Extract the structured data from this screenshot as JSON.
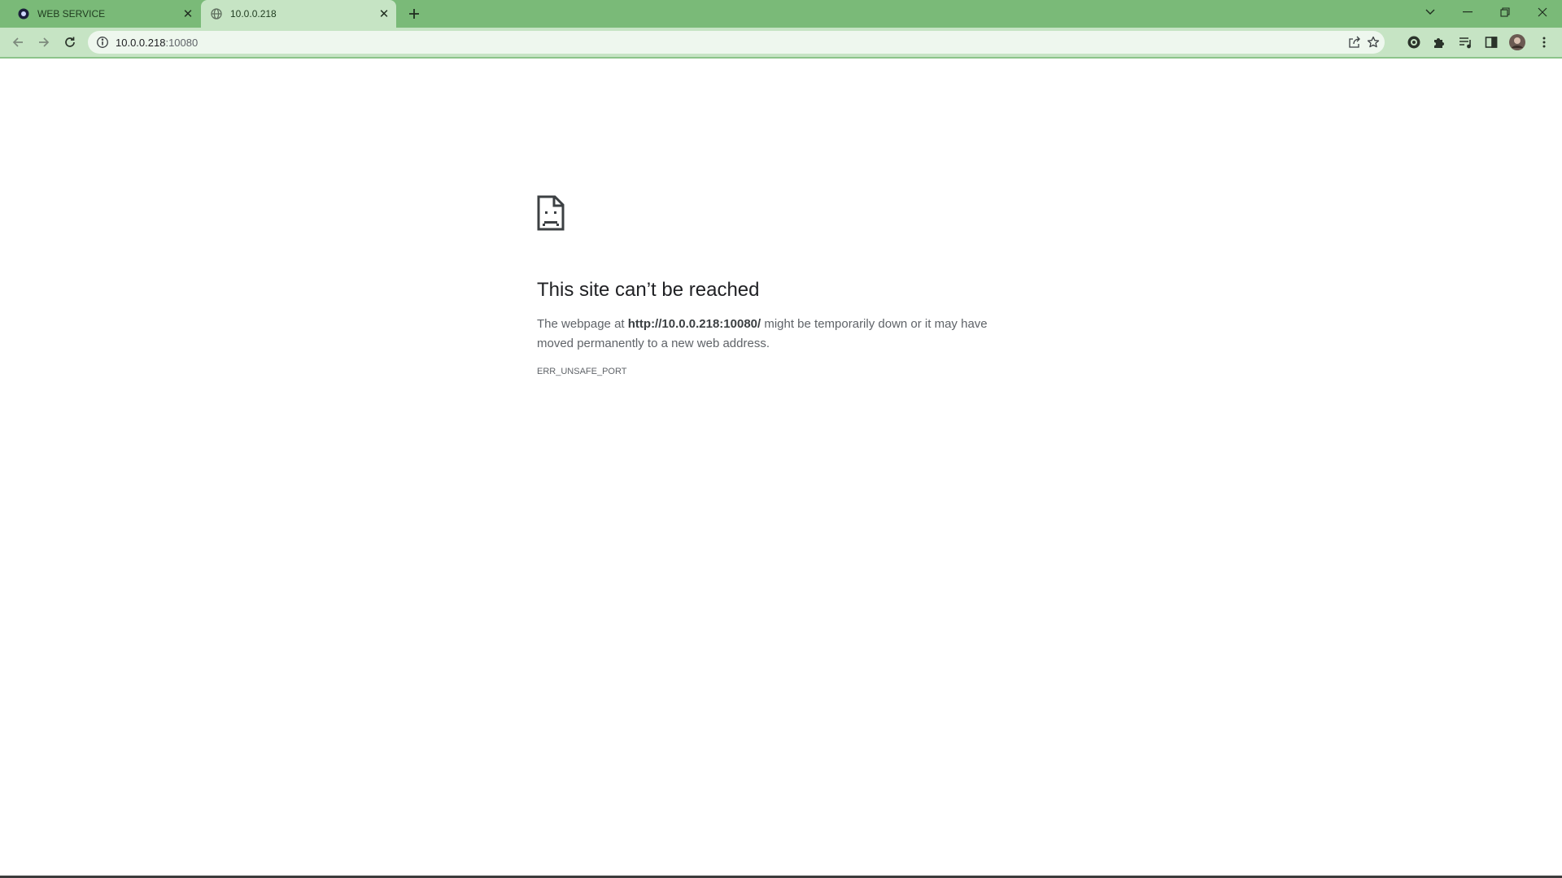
{
  "tabs": [
    {
      "title": "WEB SERVICE",
      "active": false
    },
    {
      "title": "10.0.0.218",
      "active": true
    }
  ],
  "address": {
    "host": "10.0.0.218",
    "port": ":10080"
  },
  "error": {
    "heading": "This site can’t be reached",
    "desc_prefix": "The webpage at ",
    "desc_url": "http://10.0.0.218:10080/",
    "desc_suffix": " might be temporarily down or it may have moved permanently to a new web address.",
    "code": "ERR_UNSAFE_PORT"
  },
  "icons": {
    "toolbar": [
      "back-icon",
      "forward-icon",
      "reload-icon",
      "info-icon",
      "share-icon",
      "bookmark-star-icon",
      "extension-shield-icon",
      "extensions-puzzle-icon",
      "reading-list-icon",
      "side-panel-icon",
      "profile-avatar",
      "more-menu-icon"
    ],
    "window": [
      "tab-search-icon",
      "minimize-icon",
      "restore-icon",
      "close-window-icon"
    ]
  },
  "colors": {
    "tabstrip": "#7aba78",
    "toolbar": "#c6e4c4",
    "text": "#202124",
    "secondary_text": "#5f6368"
  }
}
